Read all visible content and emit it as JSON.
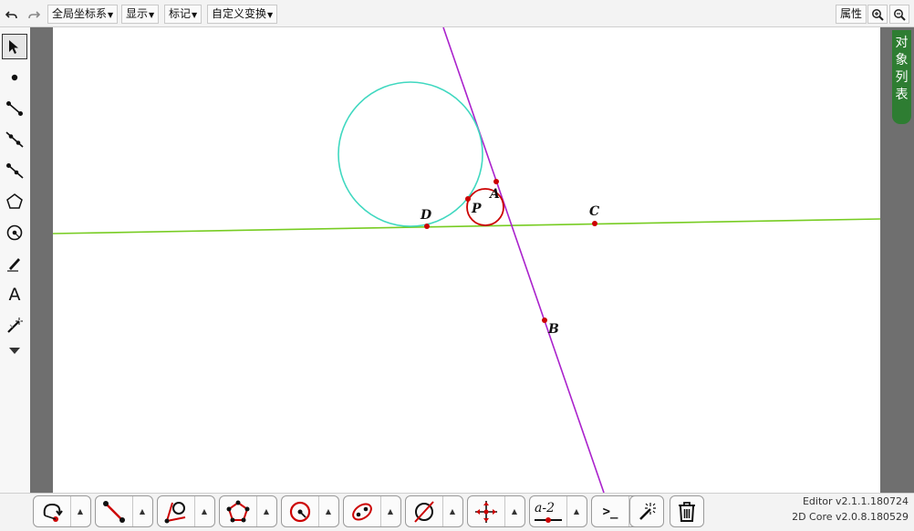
{
  "toolbar": {
    "menus": [
      "全局坐标系",
      "显示",
      "标记",
      "自定义变换"
    ],
    "properties": "属性",
    "undo_icon": "undo-icon",
    "redo_icon": "redo-icon",
    "zoom_in_icon": "zoom-in-icon",
    "zoom_out_icon": "zoom-out-icon"
  },
  "left_tools": [
    "select-arrow-icon",
    "point-icon",
    "segment-icon",
    "line-icon",
    "ray-icon",
    "polygon-icon",
    "circle-icon",
    "pen-icon",
    "text-icon",
    "magic-wand-icon",
    "more-tools-icon"
  ],
  "left_labels": {
    "text_tool": "A"
  },
  "object_list_tab": [
    "对",
    "象",
    "列",
    "表"
  ],
  "canvas": {
    "points": [
      {
        "name": "A",
        "label": "A"
      },
      {
        "name": "B",
        "label": "B"
      },
      {
        "name": "C",
        "label": "C"
      },
      {
        "name": "D",
        "label": "D"
      },
      {
        "name": "P",
        "label": "P"
      }
    ],
    "colors": {
      "big_circle": "#40d8c0",
      "small_circle": "#cc0000",
      "line_green": "#77cc22",
      "line_purple": "#aa22cc",
      "point": "#cc0000"
    }
  },
  "bottom_tools": [
    "rotate-point-icon",
    "segment-tool-icon",
    "angle-circle-icon",
    "polygon-points-icon",
    "circle-tool-icon",
    "ellipse-tool-icon",
    "empty-set-icon",
    "intersect-icon",
    "measure-icon",
    "command-icon",
    "magic-icon",
    "trash-icon"
  ],
  "bottom_labels": {
    "measure": "a-2",
    "command": ">_"
  },
  "version": {
    "editor": "Editor v2.1.1.180724",
    "core": "2D Core v2.0.8.180529"
  }
}
